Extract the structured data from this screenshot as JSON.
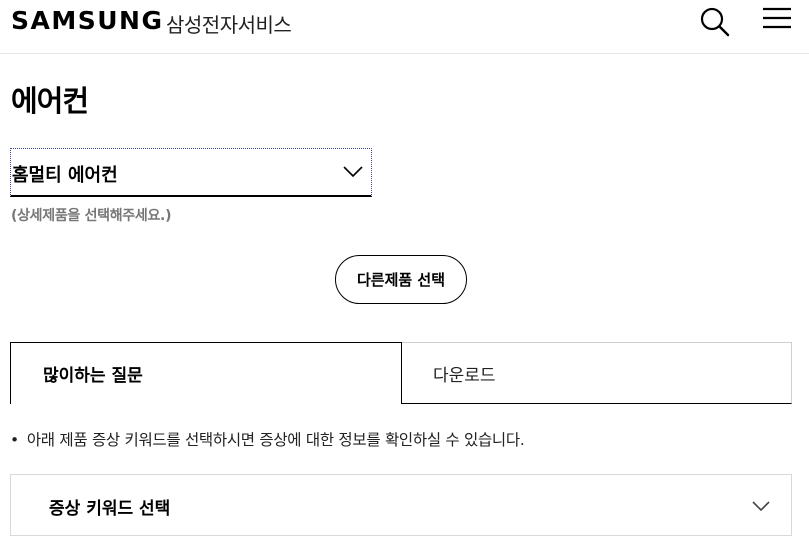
{
  "header": {
    "logo": "SAMSUNG",
    "service_name": "삼성전자서비스",
    "search_icon": "search-icon",
    "menu_icon": "hamburger-menu-icon"
  },
  "page": {
    "title": "에어컨"
  },
  "product_select": {
    "value": "홈멀티 에어컨",
    "icon": "chevron-down-icon",
    "hint": "(상세제품을 선택해주세요.)"
  },
  "other_product_button": {
    "label": "다른제품 선택"
  },
  "tabs": [
    {
      "label": "많이하는 질문",
      "active": true
    },
    {
      "label": "다운로드",
      "active": false
    }
  ],
  "notice": {
    "bullet": "•",
    "text": "아래 제품 증상 키워드를 선택하시면 증상에 대한 정보를 확인하실 수 있습니다."
  },
  "keyword_select": {
    "label": "증상 키워드 선택",
    "icon": "chevron-down-icon"
  }
}
